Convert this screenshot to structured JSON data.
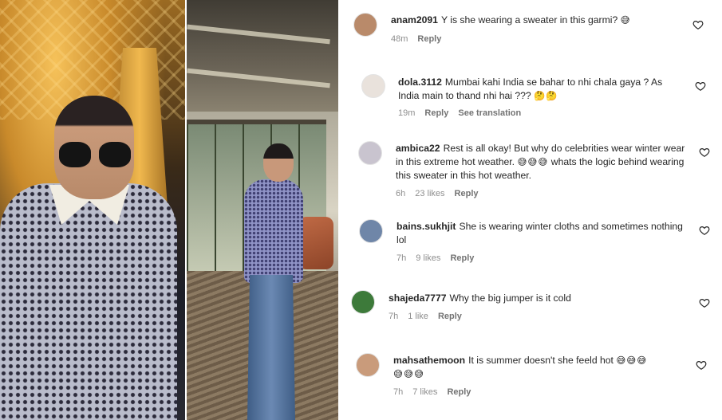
{
  "comments": [
    {
      "username": "anam2091",
      "text": "Y is she wearing a sweater in this garmi?",
      "emoji": "😅",
      "time": "48m",
      "likes": "",
      "reply_label": "Reply",
      "extra": "",
      "avatar_color": "#b98a6a"
    },
    {
      "username": "dola.3112",
      "text": "Mumbai kahi India se bahar to nhi chala gaya ? As India main to thand nhi hai ???",
      "emoji": "🤔🤔",
      "time": "19m",
      "likes": "",
      "reply_label": "Reply",
      "extra": "See translation",
      "avatar_color": "#e9e2dc"
    },
    {
      "username": "ambica22",
      "text": "Rest is all okay! But why do celebrities wear winter wear in this extreme hot weather.",
      "emoji": "😅😅😅",
      "text2": "whats the logic behind wearing this sweater in this hot weather.",
      "time": "6h",
      "likes": "23 likes",
      "reply_label": "Reply",
      "extra": "",
      "avatar_color": "#c9c4cf"
    },
    {
      "username": "bains.sukhjit",
      "text": "She is wearing winter cloths and sometimes nothing lol",
      "emoji": "",
      "time": "7h",
      "likes": "9 likes",
      "reply_label": "Reply",
      "extra": "",
      "avatar_color": "#6f86a8"
    },
    {
      "username": "shajeda7777",
      "text": "Why the big jumper is it cold",
      "emoji": "",
      "time": "7h",
      "likes": "1 like",
      "reply_label": "Reply",
      "extra": "",
      "avatar_color": "#3d7a3a"
    },
    {
      "username": "mahsathemoon",
      "text": "It is summer doesn't she feeld hot",
      "emoji": "😅😅😅",
      "emoji2": "😅😅😅",
      "time": "7h",
      "likes": "7 likes",
      "reply_label": "Reply",
      "extra": "",
      "avatar_color": "#c99b7b"
    }
  ]
}
